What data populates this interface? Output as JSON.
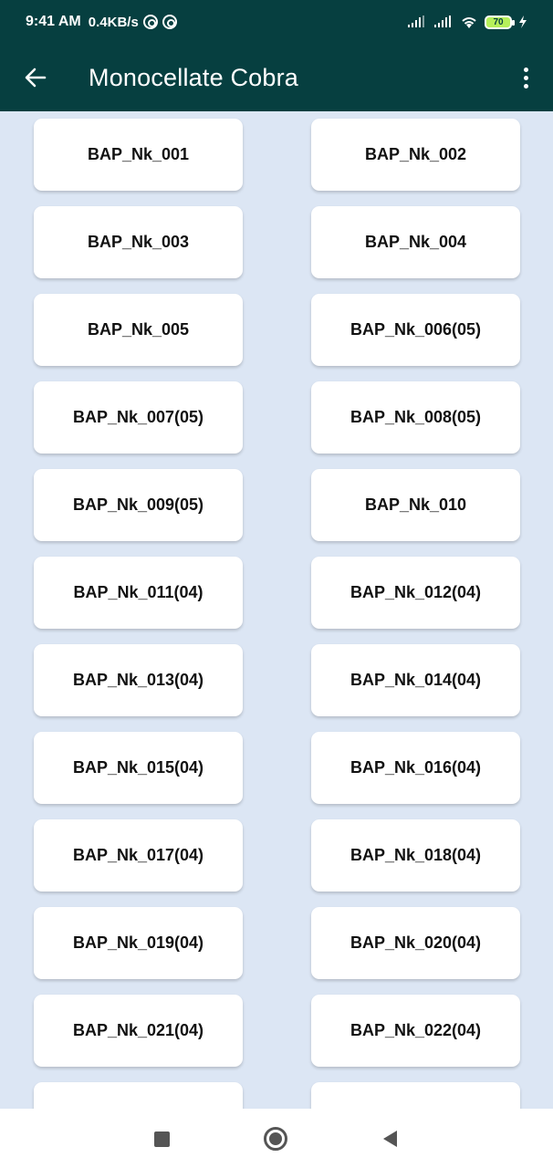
{
  "status_bar": {
    "time": "9:41 AM",
    "speed": "0.4KB/s",
    "battery": "70"
  },
  "app_bar": {
    "back_icon": "arrow-left-icon",
    "title": "Monocellate Cobra",
    "menu_icon": "more-vertical-icon"
  },
  "items": [
    "BAP_Nk_001",
    "BAP_Nk_002",
    "BAP_Nk_003",
    "BAP_Nk_004",
    "BAP_Nk_005",
    "BAP_Nk_006(05)",
    "BAP_Nk_007(05)",
    "BAP_Nk_008(05)",
    "BAP_Nk_009(05)",
    "BAP_Nk_010",
    "BAP_Nk_011(04)",
    "BAP_Nk_012(04)",
    "BAP_Nk_013(04)",
    "BAP_Nk_014(04)",
    "BAP_Nk_015(04)",
    "BAP_Nk_016(04)",
    "BAP_Nk_017(04)",
    "BAP_Nk_018(04)",
    "BAP_Nk_019(04)",
    "BAP_Nk_020(04)",
    "BAP_Nk_021(04)",
    "BAP_Nk_022(04)",
    "",
    ""
  ],
  "colors": {
    "app_bar": "#063f40",
    "background": "#dce6f4",
    "card": "#ffffff"
  },
  "nav_bar": {
    "recents_icon": "square-icon",
    "home_icon": "circle-icon",
    "back_icon": "triangle-back-icon"
  }
}
